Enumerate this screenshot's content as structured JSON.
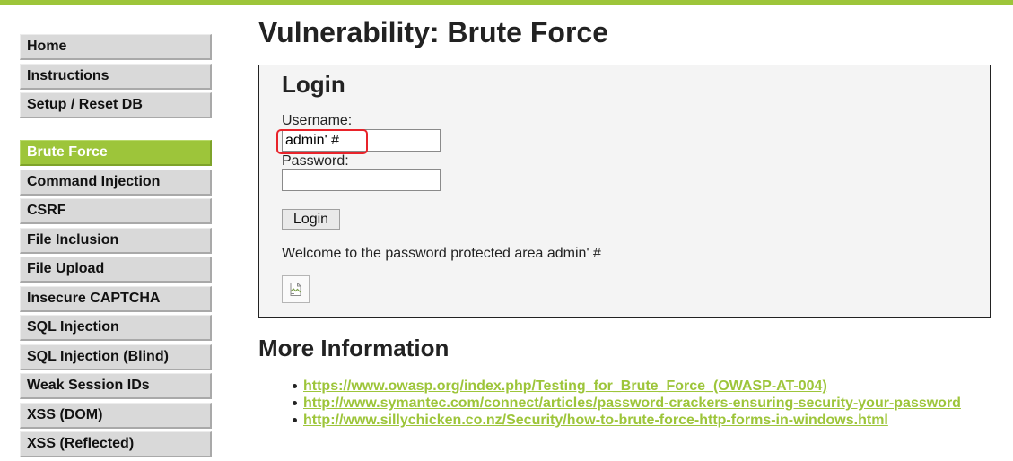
{
  "page": {
    "title": "Vulnerability: Brute Force",
    "accent_color": "#9dc53a"
  },
  "menu": {
    "group1": [
      {
        "label": "Home"
      },
      {
        "label": "Instructions"
      },
      {
        "label": "Setup / Reset DB"
      }
    ],
    "group2": [
      {
        "label": "Brute Force",
        "selected": true
      },
      {
        "label": "Command Injection"
      },
      {
        "label": "CSRF"
      },
      {
        "label": "File Inclusion"
      },
      {
        "label": "File Upload"
      },
      {
        "label": "Insecure CAPTCHA"
      },
      {
        "label": "SQL Injection"
      },
      {
        "label": "SQL Injection (Blind)"
      },
      {
        "label": "Weak Session IDs"
      },
      {
        "label": "XSS (DOM)"
      },
      {
        "label": "XSS (Reflected)"
      }
    ]
  },
  "login": {
    "heading": "Login",
    "username_label": "Username:",
    "username_value": "admin' #",
    "password_label": "Password:",
    "password_value": "",
    "button_label": "Login",
    "welcome_message": "Welcome to the password protected area admin' #",
    "image_icon": "broken-image-icon",
    "highlight_color": "#e8232a"
  },
  "more_info": {
    "heading": "More Information",
    "links": [
      "https://www.owasp.org/index.php/Testing_for_Brute_Force_(OWASP-AT-004)",
      "http://www.symantec.com/connect/articles/password-crackers-ensuring-security-your-password",
      "http://www.sillychicken.co.nz/Security/how-to-brute-force-http-forms-in-windows.html"
    ]
  }
}
